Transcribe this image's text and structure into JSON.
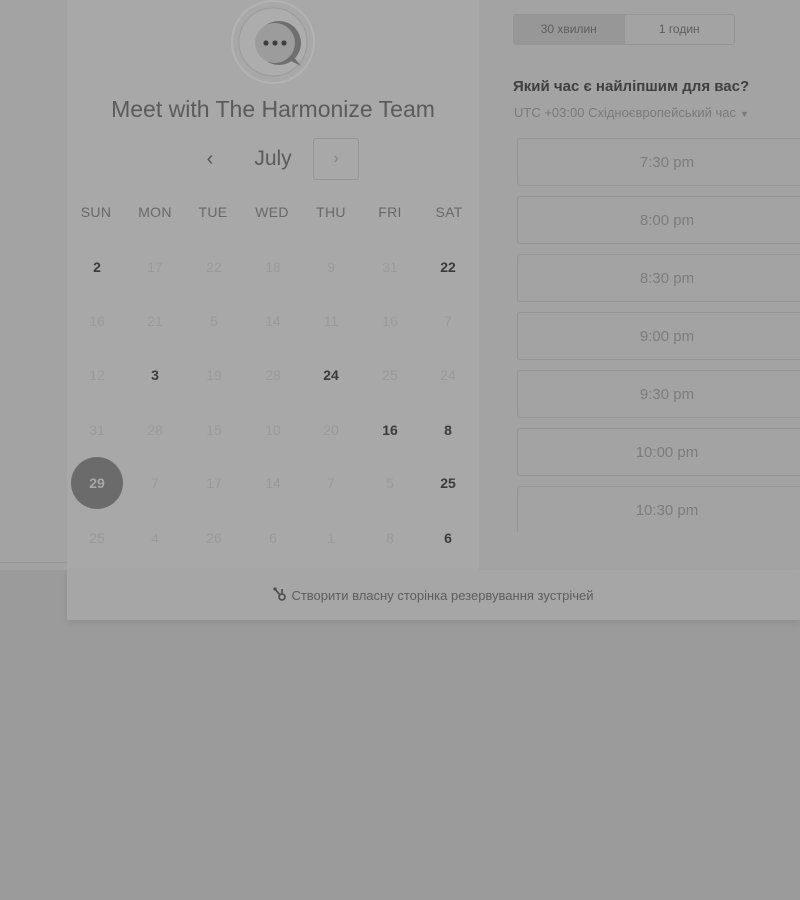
{
  "title": "Meet with The Harmonize Team",
  "calendar": {
    "prev_icon": "‹",
    "next_icon": "›",
    "month": "July",
    "weekdays": [
      "SUN",
      "MON",
      "TUE",
      "WED",
      "THU",
      "FRI",
      "SAT"
    ],
    "weeks": [
      [
        "2",
        "17",
        "22",
        "18",
        "9",
        "31",
        "22"
      ],
      [
        "16",
        "21",
        "5",
        "14",
        "11",
        "16",
        "7"
      ],
      [
        "12",
        "3",
        "19",
        "28",
        "24",
        "25",
        "24"
      ],
      [
        "31",
        "28",
        "15",
        "10",
        "20",
        "16",
        "8"
      ],
      [
        "29",
        "7",
        "17",
        "14",
        "7",
        "5",
        "25"
      ],
      [
        "25",
        "4",
        "26",
        "6",
        "1",
        "8",
        "6"
      ]
    ]
  },
  "duration": {
    "options": [
      "30 хвилин",
      "1 годин"
    ],
    "selected": "30 хвилин"
  },
  "time_question": "Який час є найліпшим для вас?",
  "timezone": "UTC +03:00 Східноєвропейський час",
  "slots": [
    "7:30 pm",
    "8:00 pm",
    "8:30 pm",
    "9:00 pm",
    "9:30 pm",
    "10:00 pm",
    "10:30 pm"
  ],
  "footer": {
    "link_text": "Створити власну сторінка резервування зустрічей"
  }
}
